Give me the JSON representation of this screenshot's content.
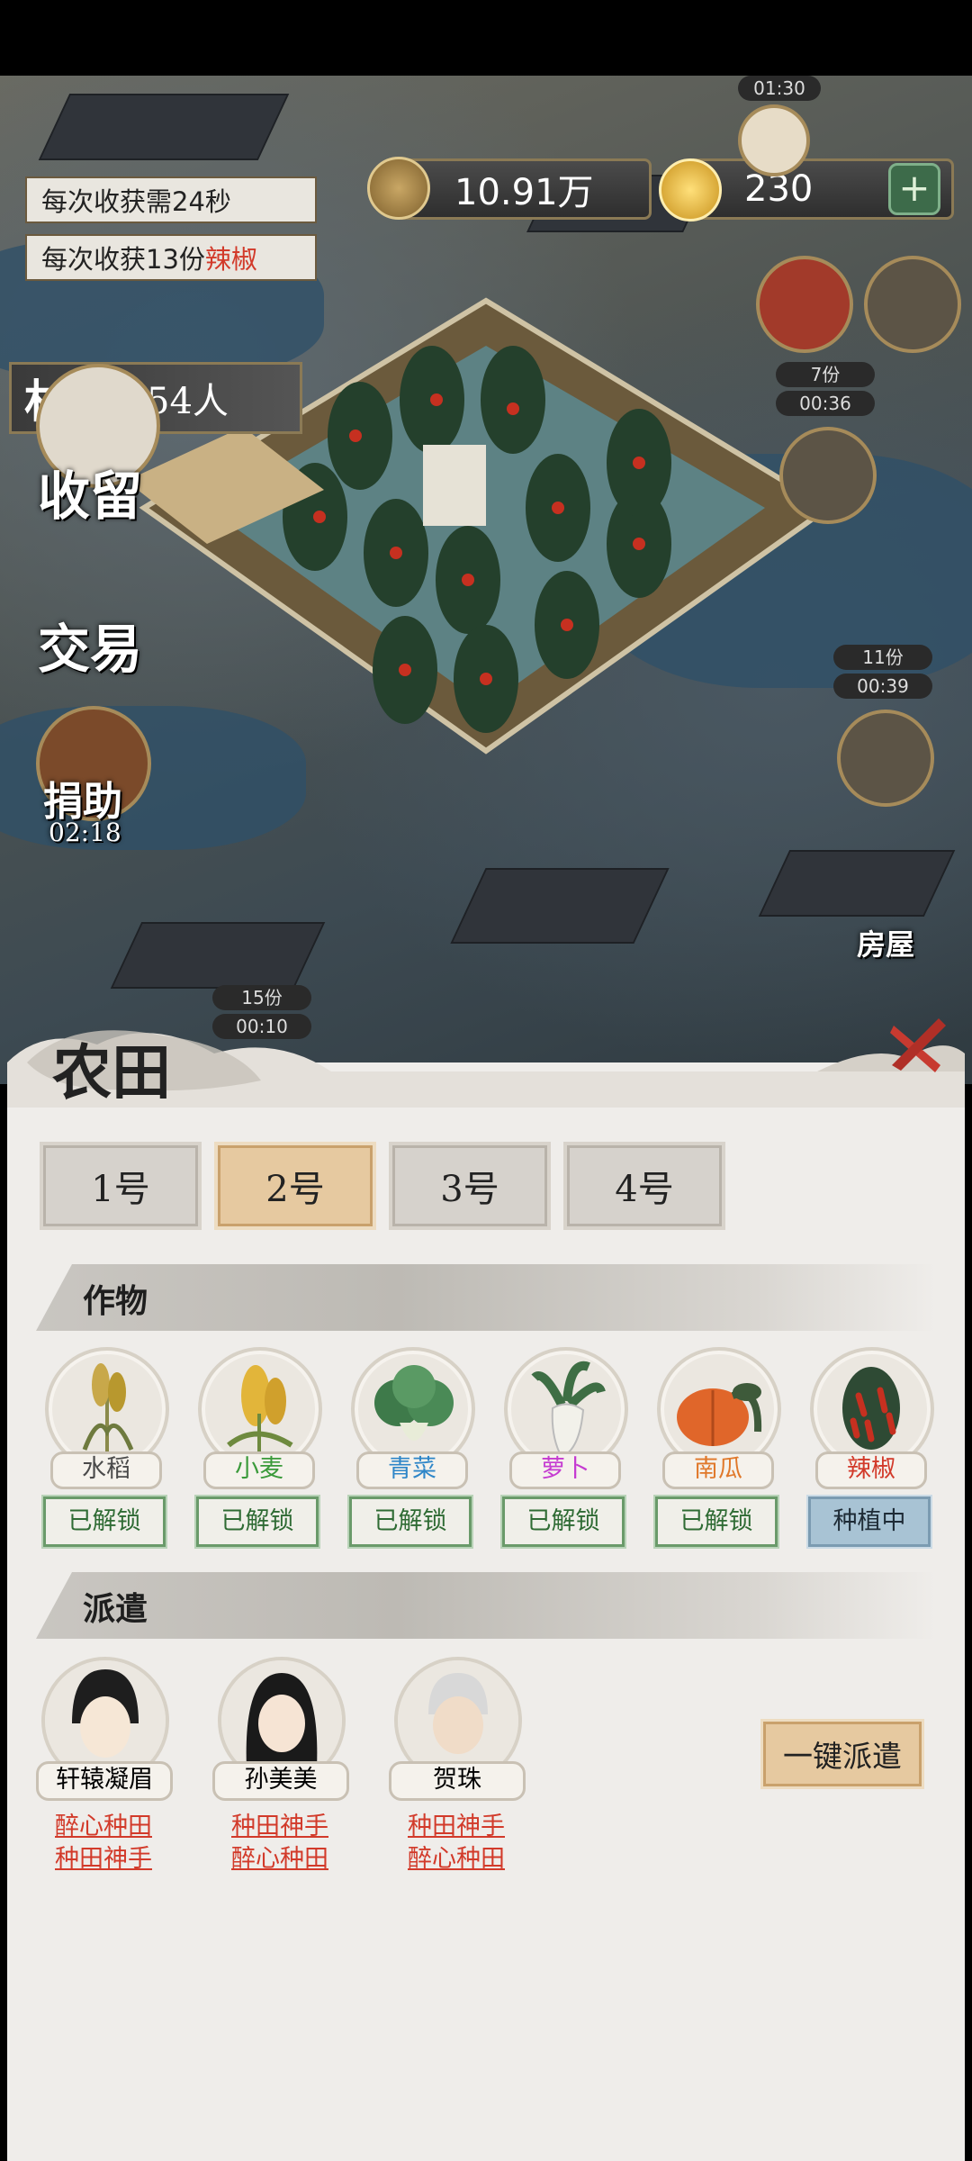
{
  "hud": {
    "harvest_time": "每次收获需24秒",
    "harvest_amount_prefix": "每次收获13份",
    "harvest_amount_crop": "辣椒",
    "money": "10.91万",
    "gold": "230",
    "villagers_label": "村民",
    "villagers_count": "54人",
    "timer_top": "01:30"
  },
  "side_menu": {
    "shelter": "收留",
    "trade": "交易",
    "donate": "捐助",
    "donate_timer": "02:18"
  },
  "map_badges": [
    {
      "count": "7份",
      "time": "00:36"
    },
    {
      "count": "11份",
      "time": "00:39"
    },
    {
      "count": "15份",
      "time": "00:10"
    }
  ],
  "map_labels": {
    "house": "房屋"
  },
  "panel": {
    "title": "农田",
    "tabs": [
      "1号",
      "2号",
      "3号",
      "4号"
    ],
    "active_tab": 1,
    "crops_section": "作物",
    "dispatch_section": "派遣",
    "crops": [
      {
        "name": "水稻",
        "status": "已解锁",
        "color": "#4a4a4a"
      },
      {
        "name": "小麦",
        "status": "已解锁",
        "color": "#3a9a3a"
      },
      {
        "name": "青菜",
        "status": "已解锁",
        "color": "#2e86c8"
      },
      {
        "name": "萝卜",
        "status": "已解锁",
        "color": "#c53bd1"
      },
      {
        "name": "南瓜",
        "status": "已解锁",
        "color": "#e0782a"
      },
      {
        "name": "辣椒",
        "status": "种植中",
        "color": "#d23a2a"
      }
    ],
    "workers": [
      {
        "name": "轩辕凝眉",
        "skills": [
          "醉心种田",
          "种田神手"
        ]
      },
      {
        "name": "孙美美",
        "skills": [
          "种田神手",
          "醉心种田"
        ]
      },
      {
        "name": "贺珠",
        "skills": [
          "种田神手",
          "醉心种田"
        ]
      }
    ],
    "dispatch_button": "一键派遣"
  }
}
